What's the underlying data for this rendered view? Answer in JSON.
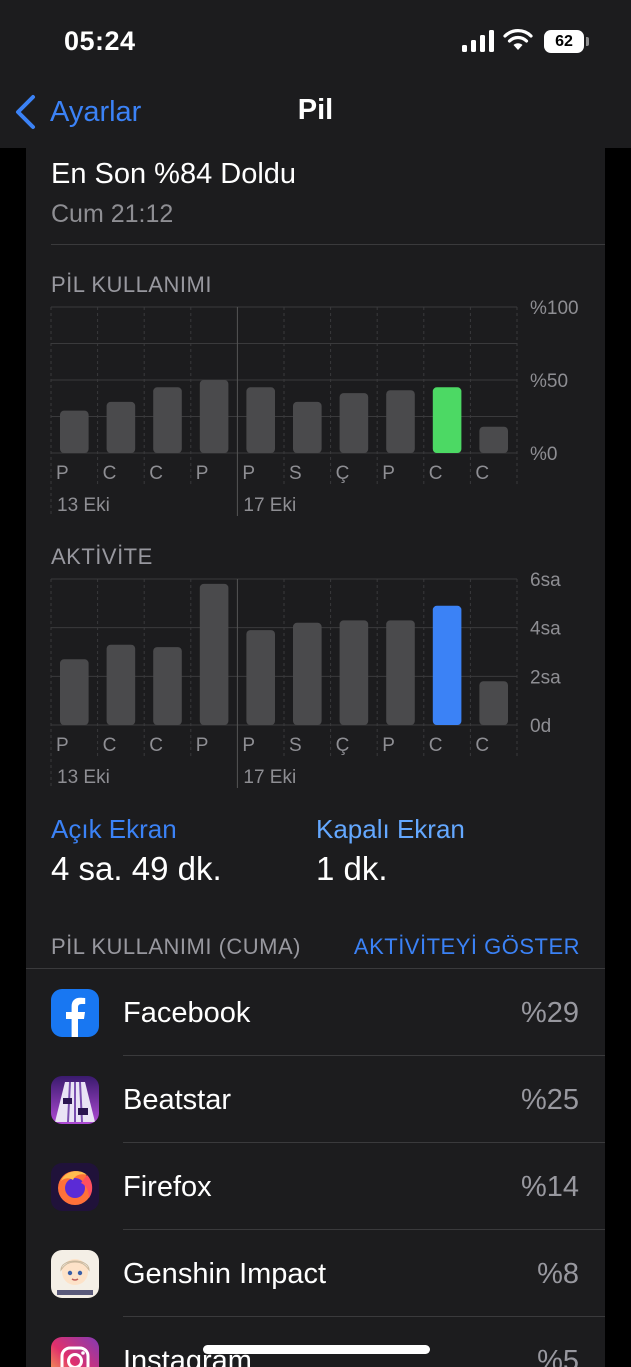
{
  "status": {
    "time": "05:24",
    "battery": "62"
  },
  "nav": {
    "back_label": "Ayarlar",
    "title": "Pil"
  },
  "last_charge": {
    "title": "En Son %84 Doldu",
    "time": "Cum 21:12"
  },
  "colors": {
    "accent": "#3b82f6",
    "bar": "#4a4a4c",
    "highlight_battery": "#4cd964",
    "highlight_activity": "#3b82f6"
  },
  "chart_data": [
    {
      "type": "bar",
      "title": "PİL KULLANIMI",
      "categories": [
        "P",
        "C",
        "C",
        "P",
        "P",
        "S",
        "Ç",
        "P",
        "C",
        "C"
      ],
      "date_labels": [
        "13 Eki",
        "17 Eki"
      ],
      "values": [
        29,
        35,
        45,
        50,
        45,
        35,
        41,
        43,
        45,
        18
      ],
      "highlight_index": 8,
      "y_ticks": [
        "%100",
        "%50",
        "%0"
      ],
      "ylim": [
        0,
        100
      ]
    },
    {
      "type": "bar",
      "title": "AKTİVİTE",
      "categories": [
        "P",
        "C",
        "C",
        "P",
        "P",
        "S",
        "Ç",
        "P",
        "C",
        "C"
      ],
      "date_labels": [
        "13 Eki",
        "17 Eki"
      ],
      "values": [
        2.7,
        3.3,
        3.2,
        5.8,
        3.9,
        4.2,
        4.3,
        4.3,
        4.9,
        1.8
      ],
      "highlight_index": 8,
      "y_ticks": [
        "6sa",
        "4sa",
        "2sa",
        "0d"
      ],
      "ylim": [
        0,
        6
      ]
    }
  ],
  "screen_on": {
    "label": "Açık Ekran",
    "value": "4 sa. 49 dk."
  },
  "screen_off": {
    "label": "Kapalı Ekran",
    "value": "1 dk."
  },
  "usage": {
    "header": "PİL KULLANIMI (CUMA)",
    "show_activity": "AKTİVİTEYİ GÖSTER",
    "apps": [
      {
        "name": "Facebook",
        "percent": "%29",
        "icon": "facebook-icon"
      },
      {
        "name": "Beatstar",
        "percent": "%25",
        "icon": "beatstar-icon"
      },
      {
        "name": "Firefox",
        "percent": "%14",
        "icon": "firefox-icon"
      },
      {
        "name": "Genshin Impact",
        "percent": "%8",
        "icon": "genshin-impact-icon"
      },
      {
        "name": "Instagram",
        "percent": "%5",
        "icon": "instagram-icon"
      }
    ]
  }
}
